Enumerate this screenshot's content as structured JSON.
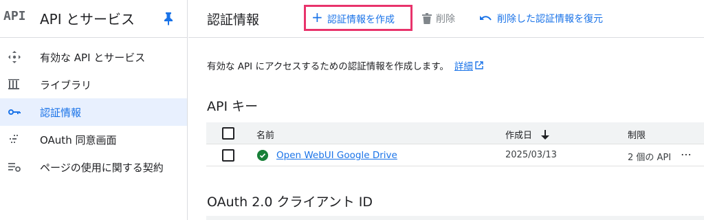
{
  "sidebar": {
    "logo": "API",
    "title": "API とサービス",
    "items": [
      {
        "label": "有効な API とサービス",
        "icon": "api-services-icon",
        "active": false
      },
      {
        "label": "ライブラリ",
        "icon": "library-icon",
        "active": false
      },
      {
        "label": "認証情報",
        "icon": "key-icon",
        "active": true
      },
      {
        "label": "OAuth 同意画面",
        "icon": "oauth-consent-icon",
        "active": false
      },
      {
        "label": "ページの使用に関する契約",
        "icon": "page-usage-settings-icon",
        "active": false
      }
    ]
  },
  "toolbar": {
    "page_title": "認証情報",
    "create_label": "認証情報を作成",
    "delete_label": "削除",
    "restore_label": "削除した認証情報を復元"
  },
  "main": {
    "description": "有効な API にアクセスするための認証情報を作成します。",
    "details_link": "詳細",
    "api_keys_title": "API キー",
    "oauth_title": "OAuth 2.0 クライアント ID",
    "table": {
      "columns": {
        "name": "名前",
        "created": "作成日",
        "limit": "制限"
      },
      "rows": [
        {
          "name": "Open WebUI Google Drive",
          "created": "2025/03/13",
          "limit": "2 個の API"
        }
      ]
    }
  },
  "colors": {
    "accent": "#1a73e8",
    "highlight_border": "#e8336b",
    "active_bg": "#e8f0fe",
    "status_ok": "#188038"
  }
}
